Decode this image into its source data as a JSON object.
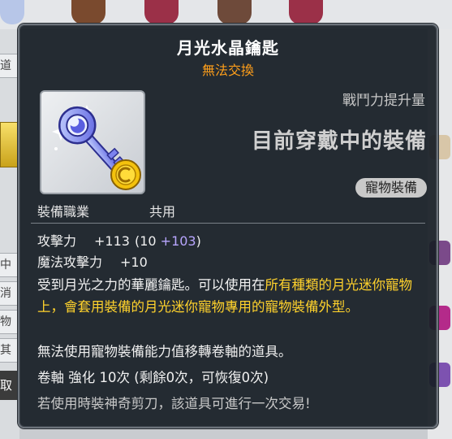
{
  "item": {
    "name": "月光水晶鑰匙",
    "trade_status": "無法交換",
    "power_label": "戰鬥力提升量",
    "equipped_label": "目前穿戴中的裝備",
    "category_badge": "寵物裝備",
    "job_label": "裝備職業",
    "job_value": "共用",
    "stats": [
      {
        "name": "攻擊力",
        "value": "+113",
        "base": "(10 ",
        "bonus": "+103",
        "close": ")"
      },
      {
        "name": "魔法攻擊力",
        "value": "+10"
      }
    ],
    "description": {
      "part1": "受到月光之力的華麗鑰匙。可以使用在",
      "highlight1": "所有種類的月光迷你寵物上，會套用裝備的月光迷你寵物專用的寵物裝備外型。",
      "line_transfer": "無法使用寵物裝備能力值移轉卷軸的道具。",
      "line_scroll": "卷軸 強化 10次 (剩餘0次，可恢復0次)",
      "line_scissors": "若使用時裝神奇剪刀，該道具可進行一次交易!"
    }
  },
  "background": {
    "left_tabs": [
      "道",
      "中",
      "消",
      "物",
      "其"
    ],
    "left_bottom": "取"
  },
  "colors": {
    "trade": "#ff9f1a",
    "highlight": "#ffd22c",
    "bonus": "#b8a6ff"
  },
  "icons": [
    "moonlight-crystal-key-icon",
    "gold-coin-icon"
  ]
}
